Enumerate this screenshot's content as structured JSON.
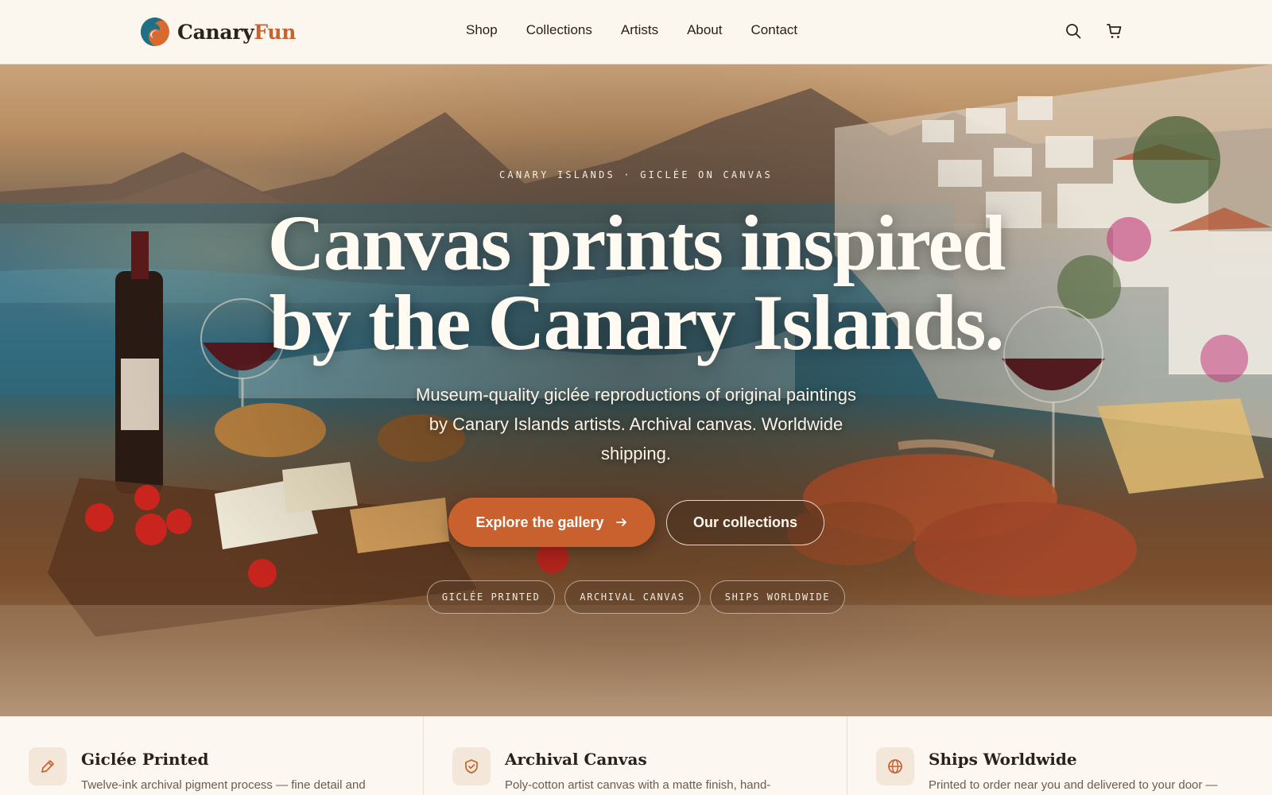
{
  "brand": {
    "name_part1": "Canary",
    "name_part2": "Fun"
  },
  "nav": {
    "items": [
      {
        "label": "Shop"
      },
      {
        "label": "Collections"
      },
      {
        "label": "Artists"
      },
      {
        "label": "About"
      },
      {
        "label": "Contact"
      }
    ],
    "icons": [
      "search-icon",
      "cart-icon"
    ]
  },
  "hero": {
    "eyebrow": "CANARY ISLANDS · GICLÉE ON CANVAS",
    "headline_line1": "Canvas prints inspired",
    "headline_line2": "by the Canary Islands.",
    "subtitle": "Museum-quality giclée reproductions of original paintings by Canary Islands artists. Archival canvas. Worldwide shipping.",
    "primary_cta": "Explore the gallery",
    "secondary_cta": "Our collections",
    "chips": [
      {
        "label": "GICLÉE PRINTED"
      },
      {
        "label": "ARCHIVAL CANVAS"
      },
      {
        "label": "SHIPS WORLDWIDE"
      }
    ]
  },
  "features": [
    {
      "icon": "brush-icon",
      "title": "Giclée Printed",
      "text": "Twelve-ink archival pigment process — fine detail and"
    },
    {
      "icon": "shield-check-icon",
      "title": "Archival Canvas",
      "text": "Poly-cotton artist canvas with a matte finish, hand-"
    },
    {
      "icon": "globe-icon",
      "title": "Ships Worldwide",
      "text": "Printed to order near you and delivered to your door —"
    }
  ],
  "colors": {
    "accent": "#c9612e",
    "background": "#fbf6ee",
    "text": "#2a2118"
  }
}
